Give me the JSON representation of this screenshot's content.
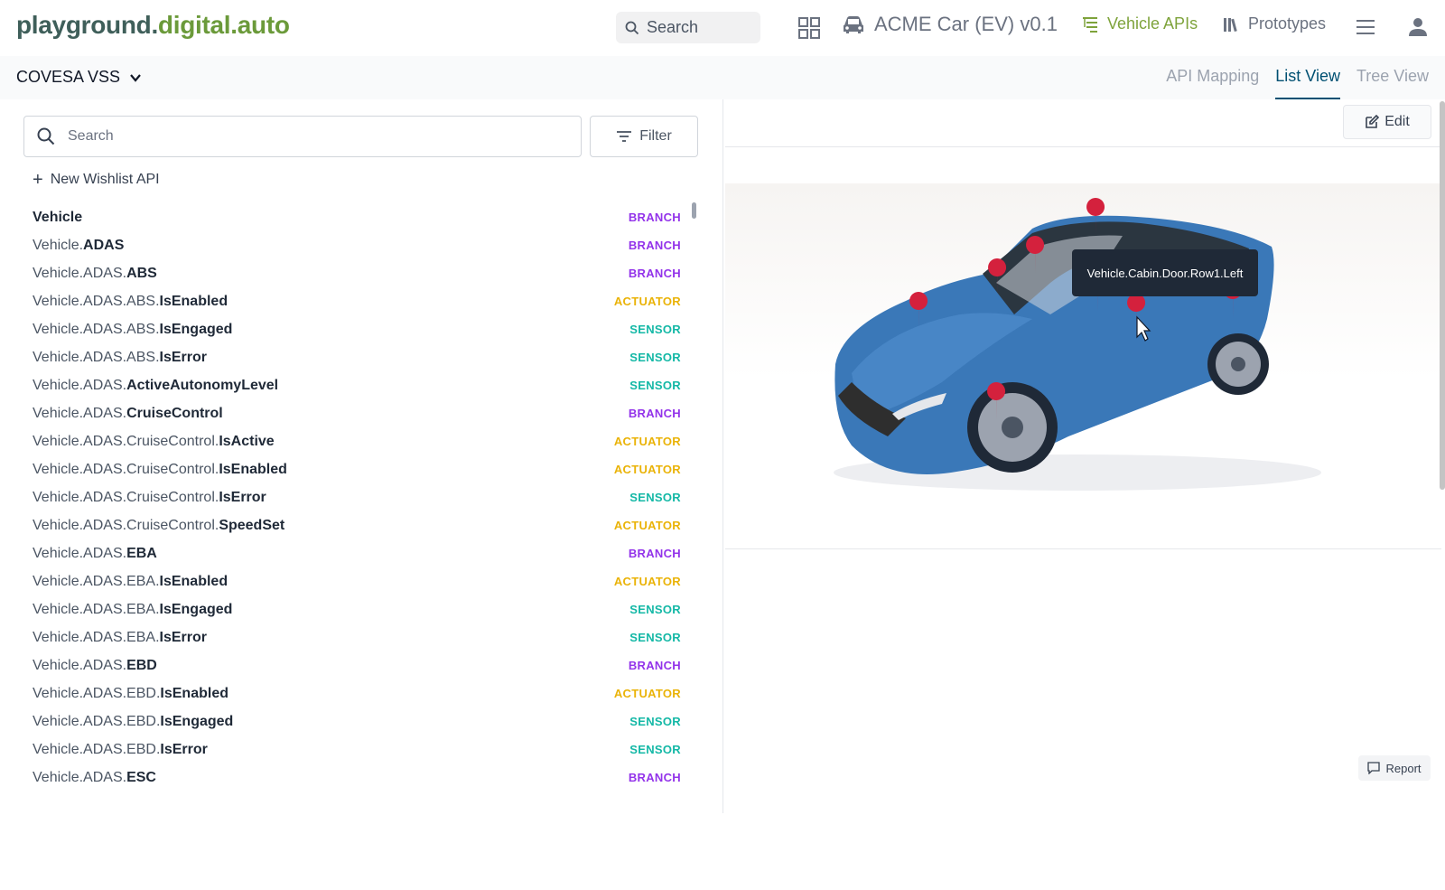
{
  "header": {
    "logo_part1": "playground.",
    "logo_part2": "digital.auto",
    "search_label": "Search",
    "car_name": "ACME Car (EV) v0.1",
    "nav_vehicle_apis": "Vehicle APIs",
    "nav_prototypes": "Prototypes"
  },
  "subbar": {
    "standard": "COVESA VSS",
    "tabs": [
      "API Mapping",
      "List View",
      "Tree View"
    ],
    "active_tab": "List View"
  },
  "left": {
    "search_placeholder": "Search",
    "filter_label": "Filter",
    "wishlist_label": "New Wishlist API",
    "apis": [
      {
        "prefix": "",
        "leaf": "Vehicle",
        "type": "BRANCH"
      },
      {
        "prefix": "Vehicle.",
        "leaf": "ADAS",
        "type": "BRANCH"
      },
      {
        "prefix": "Vehicle.ADAS.",
        "leaf": "ABS",
        "type": "BRANCH"
      },
      {
        "prefix": "Vehicle.ADAS.ABS.",
        "leaf": "IsEnabled",
        "type": "ACTUATOR"
      },
      {
        "prefix": "Vehicle.ADAS.ABS.",
        "leaf": "IsEngaged",
        "type": "SENSOR"
      },
      {
        "prefix": "Vehicle.ADAS.ABS.",
        "leaf": "IsError",
        "type": "SENSOR"
      },
      {
        "prefix": "Vehicle.ADAS.",
        "leaf": "ActiveAutonomyLevel",
        "type": "SENSOR"
      },
      {
        "prefix": "Vehicle.ADAS.",
        "leaf": "CruiseControl",
        "type": "BRANCH"
      },
      {
        "prefix": "Vehicle.ADAS.CruiseControl.",
        "leaf": "IsActive",
        "type": "ACTUATOR"
      },
      {
        "prefix": "Vehicle.ADAS.CruiseControl.",
        "leaf": "IsEnabled",
        "type": "ACTUATOR"
      },
      {
        "prefix": "Vehicle.ADAS.CruiseControl.",
        "leaf": "IsError",
        "type": "SENSOR"
      },
      {
        "prefix": "Vehicle.ADAS.CruiseControl.",
        "leaf": "SpeedSet",
        "type": "ACTUATOR"
      },
      {
        "prefix": "Vehicle.ADAS.",
        "leaf": "EBA",
        "type": "BRANCH"
      },
      {
        "prefix": "Vehicle.ADAS.EBA.",
        "leaf": "IsEnabled",
        "type": "ACTUATOR"
      },
      {
        "prefix": "Vehicle.ADAS.EBA.",
        "leaf": "IsEngaged",
        "type": "SENSOR"
      },
      {
        "prefix": "Vehicle.ADAS.EBA.",
        "leaf": "IsError",
        "type": "SENSOR"
      },
      {
        "prefix": "Vehicle.ADAS.",
        "leaf": "EBD",
        "type": "BRANCH"
      },
      {
        "prefix": "Vehicle.ADAS.EBD.",
        "leaf": "IsEnabled",
        "type": "ACTUATOR"
      },
      {
        "prefix": "Vehicle.ADAS.EBD.",
        "leaf": "IsEngaged",
        "type": "SENSOR"
      },
      {
        "prefix": "Vehicle.ADAS.EBD.",
        "leaf": "IsError",
        "type": "SENSOR"
      },
      {
        "prefix": "Vehicle.ADAS.",
        "leaf": "ESC",
        "type": "BRANCH"
      }
    ]
  },
  "right": {
    "edit_label": "Edit",
    "tooltip": "Vehicle.Cabin.Door.Row1.Left",
    "report_label": "Report"
  },
  "colors": {
    "brand_dark": "#3f5f5a",
    "brand_green": "#6b9a3a",
    "active_tab": "#005072",
    "branch": "#9333ea",
    "actuator": "#eab308",
    "sensor": "#14b8a6",
    "pin": "#d4213d",
    "car_body": "#3a78b8"
  }
}
